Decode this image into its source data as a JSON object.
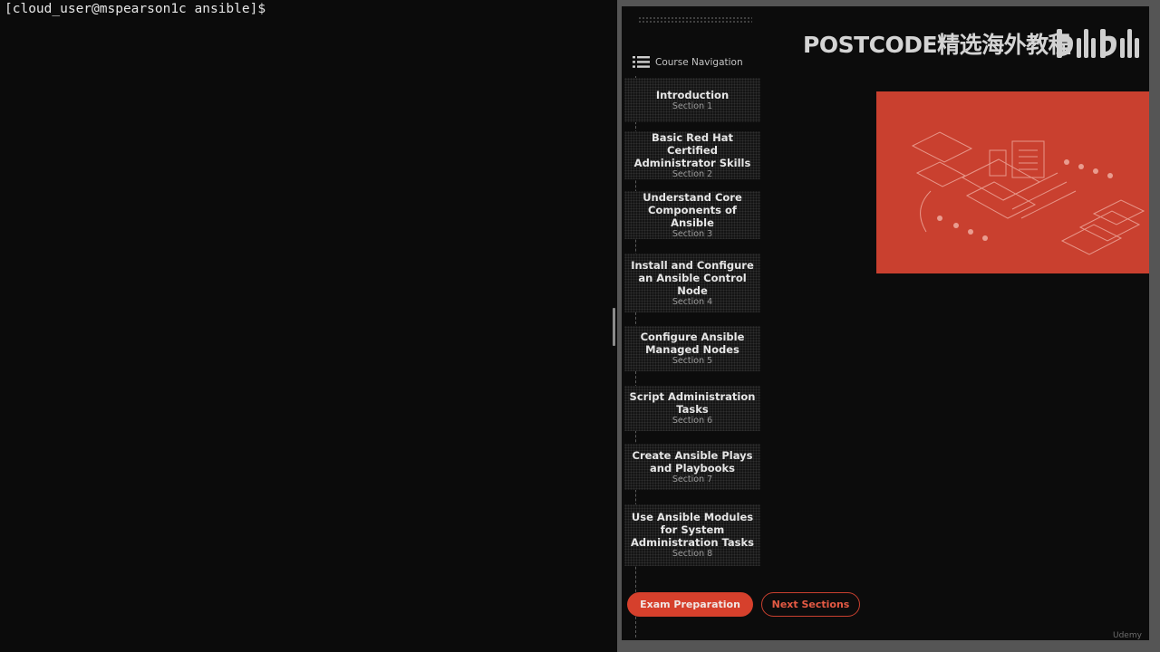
{
  "terminal": {
    "prompt": "[cloud_user@mspearson1c ansible]$"
  },
  "slide": {
    "watermark": "POSTCODE精选海外教程",
    "watermark_brand": "BILIBILI",
    "nav_title": "Course Navigation",
    "sections": [
      {
        "title": "Introduction",
        "subtitle": "Section 1"
      },
      {
        "title": "Basic Red Hat Certified Administrator Skills",
        "subtitle": "Section 2"
      },
      {
        "title": "Understand Core Components of Ansible",
        "subtitle": "Section 3"
      },
      {
        "title": "Install and Configure an Ansible Control Node",
        "subtitle": "Section 4"
      },
      {
        "title": "Configure Ansible Managed Nodes",
        "subtitle": "Section 5"
      },
      {
        "title": "Script Administration Tasks",
        "subtitle": "Section 6"
      },
      {
        "title": "Create Ansible Plays and Playbooks",
        "subtitle": "Section 7"
      },
      {
        "title": "Use Ansible Modules for System Administration Tasks",
        "subtitle": "Section 8"
      }
    ],
    "exam_button": "Exam Preparation",
    "next_button": "Next Sections",
    "footer_brand": "Udemy",
    "colors": {
      "accent": "#c9402f",
      "background": "#0c0c0c",
      "card": "#141414"
    }
  }
}
